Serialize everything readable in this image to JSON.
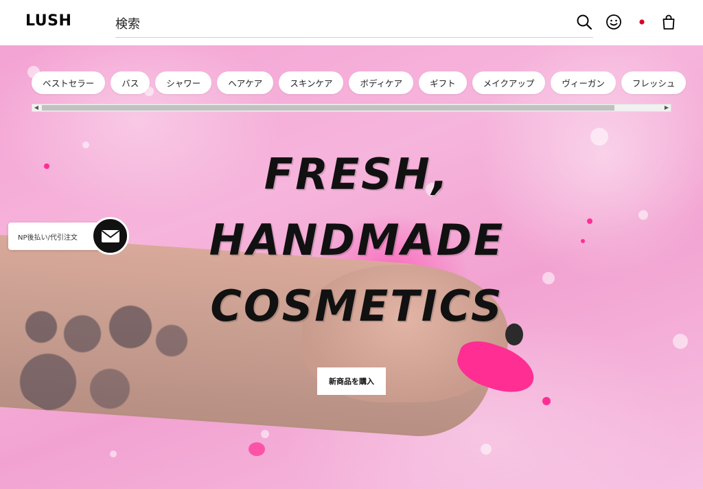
{
  "header": {
    "logo": "LUSH",
    "search_placeholder": "検索",
    "icons": [
      "search-icon",
      "account-icon",
      "japan-flag-icon",
      "shopping-bag-icon"
    ]
  },
  "categories": [
    "ベストセラー",
    "バス",
    "シャワー",
    "ヘアケア",
    "スキンケア",
    "ボディケア",
    "ギフト",
    "メイクアップ",
    "ヴィーガン",
    "フレッシュ"
  ],
  "hero": {
    "headline_line1": "FRESH,",
    "headline_line2": "HANDMADE",
    "headline_line3": "COSMETICS",
    "cta_label": "新商品を購入"
  },
  "np_widget": {
    "label": "NP後払い/代引注文",
    "icon": "mail-icon"
  },
  "colors": {
    "accent_pink": "#ff2e93",
    "hero_bg": "#f4a3d3",
    "text": "#111111",
    "flag_red": "#d7002a"
  }
}
